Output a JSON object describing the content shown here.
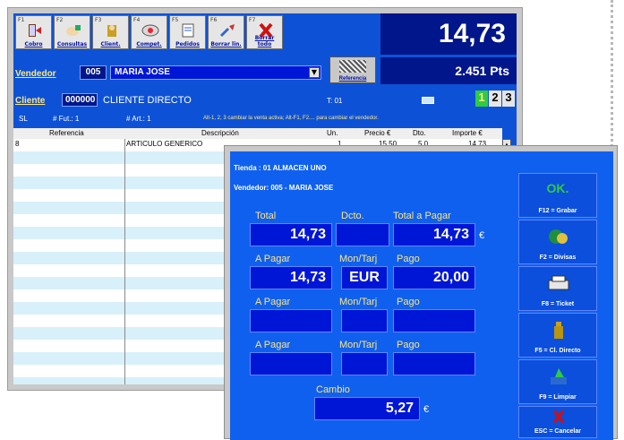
{
  "toolbar": {
    "buttons": [
      {
        "key": "F1",
        "label": "Cobro",
        "icon": "exit-icon"
      },
      {
        "key": "F2",
        "label": "Consultas",
        "icon": "hand-search-icon"
      },
      {
        "key": "F3",
        "label": "Client.",
        "icon": "client-icon"
      },
      {
        "key": "F4",
        "label": "Compet.",
        "icon": "compare-icon"
      },
      {
        "key": "F5",
        "label": "Pedidos",
        "icon": "orders-icon"
      },
      {
        "key": "F6",
        "label": "Borrar lin.",
        "icon": "erase-line-icon"
      },
      {
        "key": "F7",
        "label": "Borrar todo",
        "icon": "delete-all-icon"
      }
    ],
    "total": "14,73",
    "points": "2.451 Pts"
  },
  "seller": {
    "label": "Vendedor",
    "code": "005",
    "name": "MARIA JOSE",
    "reference_label": "Referencia"
  },
  "customer": {
    "label": "Cliente",
    "code": "000000",
    "name": "CLIENTE DIRECTO",
    "terminal": "T: 01",
    "slots": [
      "1",
      "2",
      "3"
    ]
  },
  "status": {
    "sl": "SL",
    "lines": "# Fut.: 1",
    "articles": "# Art.: 1",
    "hint": "Alt-1, 2, 3 cambiar la venta activa; Alt-F1, F2.... para cambiar el vendedor."
  },
  "grid": {
    "headers": [
      "Referencia",
      "Descripción",
      "Un.",
      "Precio €",
      "Dto.",
      "Importe €"
    ],
    "rows": [
      {
        "ref": "8",
        "desc": "ARTICULO GENERICO",
        "un": "1",
        "precio": "15,50",
        "dto": "5,0",
        "importe": "14,73"
      }
    ]
  },
  "dialog": {
    "store": "Tienda : 01 ALMACEN UNO",
    "seller": "Vendedor: 005 -  MARIA JOSE",
    "labels": {
      "total": "Total",
      "dto": "Dcto.",
      "total_pagar": "Total a Pagar",
      "a_pagar": "A Pagar",
      "mon_tar": "Mon/Tarj",
      "pago": "Pago",
      "cambio": "Cambio"
    },
    "values": {
      "total": "14,73",
      "dto": "",
      "total_pagar": "14,73",
      "currency_symbol": "€",
      "pay1_amount": "14,73",
      "pay1_currency": "EUR",
      "pay1_paid": "20,00",
      "cambio": "5,27"
    },
    "side_buttons": [
      {
        "label": "F12 = Grabar",
        "icon": "ok-icon",
        "text": "OK."
      },
      {
        "label": "F2 = Divisas",
        "icon": "currency-icon"
      },
      {
        "label": "F8 = Ticket",
        "icon": "printer-icon"
      },
      {
        "label": "F5 = Cl. Directo",
        "icon": "bottle-icon"
      },
      {
        "label": "F9 = Limpiar",
        "icon": "clean-icon"
      },
      {
        "label": "ESC = Cancelar",
        "icon": "cancel-icon"
      }
    ]
  },
  "colors": {
    "window_blue": "#0d52d6",
    "dark_navy": "#00168a",
    "dialog_blue": "#1060ef",
    "label_yellow": "#ffe680",
    "grid_cyan": "#d8f0fa",
    "accent_green": "#2ecc40"
  }
}
